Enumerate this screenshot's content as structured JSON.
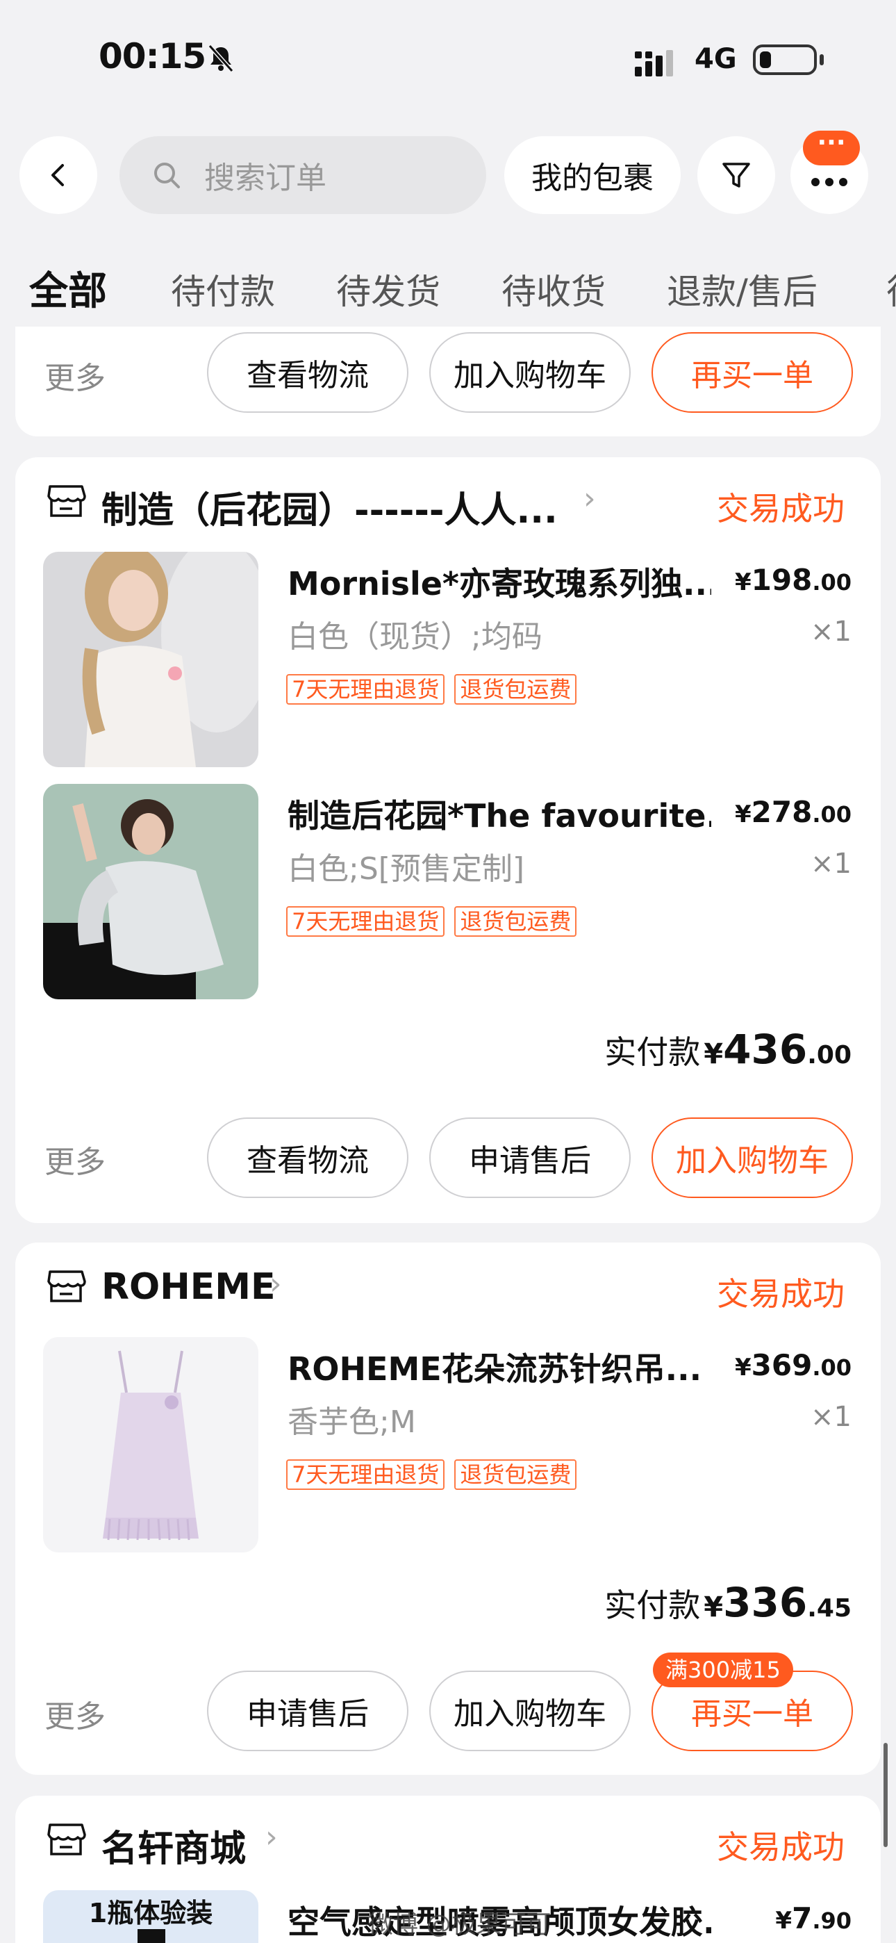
{
  "status_bar": {
    "time": "00:15",
    "network": "4G"
  },
  "header": {
    "search_placeholder": "搜索订单",
    "packages_label": "我的包裹",
    "more_badge": "···"
  },
  "tabs": [
    "全部",
    "待付款",
    "待发货",
    "待收货",
    "退款/售后",
    "待"
  ],
  "top_card": {
    "more": "更多",
    "buttons": [
      "查看物流",
      "加入购物车",
      "再买一单"
    ]
  },
  "orders": [
    {
      "store": "制造（后花园）------人人...",
      "status": "交易成功",
      "items": [
        {
          "title": "Mornisle*亦寄玫瑰系列独...",
          "sku": "白色（现货）;均码",
          "price_int": "198",
          "price_dec": ".00",
          "qty": "×1",
          "tags": [
            "7天无理由退货",
            "退货包运费"
          ]
        },
        {
          "title": "制造后花园*The favourite...",
          "sku": "白色;S[预售定制]",
          "price_int": "278",
          "price_dec": ".00",
          "qty": "×1",
          "tags": [
            "7天无理由退货",
            "退货包运费"
          ]
        }
      ],
      "paid_label": "实付款",
      "paid_int": "436",
      "paid_dec": ".00",
      "more": "更多",
      "buttons": [
        "查看物流",
        "申请售后",
        "加入购物车"
      ]
    },
    {
      "store": "ROHEME",
      "status": "交易成功",
      "items": [
        {
          "title": "ROHEME花朵流苏针织吊...",
          "sku": "香芋色;M",
          "price_int": "369",
          "price_dec": ".00",
          "qty": "×1",
          "tags": [
            "7天无理由退货",
            "退货包运费"
          ]
        }
      ],
      "paid_label": "实付款",
      "paid_int": "336",
      "paid_dec": ".45",
      "more": "更多",
      "promo": "满300减15",
      "buttons": [
        "申请售后",
        "加入购物车",
        "再买一单"
      ]
    },
    {
      "store": "名轩商城",
      "status": "交易成功",
      "items": [
        {
          "title": "空气感定型喷雾高颅顶女发胶...",
          "thumb_label": "1瓶体验装",
          "price_int": "7",
          "price_dec": ".90"
        }
      ]
    }
  ],
  "currency": "¥",
  "watermark": "微博 @极果可可",
  "colors": {
    "accent": "#ff5a1f",
    "background": "#f2f2f4"
  }
}
